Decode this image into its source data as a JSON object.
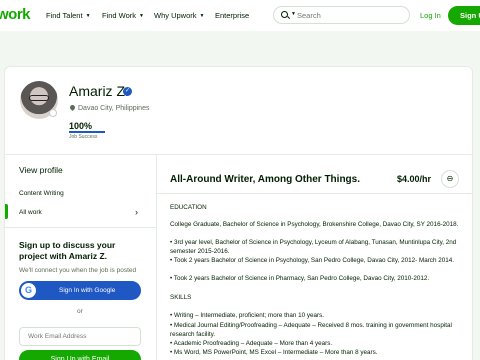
{
  "nav": {
    "logo": "work",
    "items": [
      "Find Talent",
      "Find Work",
      "Why Upwork",
      "Enterprise"
    ],
    "search_placeholder": "Search",
    "login": "Log In",
    "signup": "Sign Up"
  },
  "profile": {
    "name": "Amariz Z.",
    "location": "Davao City, Philippines",
    "job_success": "100%",
    "job_success_label": "Job Success",
    "job_success_fraction": 1.0
  },
  "sidebar": {
    "view_profile": "View profile",
    "items": [
      "Content Writing",
      "All work"
    ],
    "signup_title": "Sign up to discuss your project with Amariz Z.",
    "signup_sub": "We'll connect you when the job is posted",
    "google_button": "Sign In with Google",
    "or": "or",
    "email_placeholder": "Work Email Address",
    "email_button": "Sign Up with Email"
  },
  "main": {
    "title": "All-Around Writer, Among Other Things.",
    "rate": "$4.00/hr",
    "lines": [
      "EDUCATION",
      "College Graduate, Bachelor of Science in Psychology, Brokenshire College, Davao City, SY 2016-2018.",
      "• 3rd year level, Bachelor of Science in Psychology, Lyceum of Alabang, Tunasan, Muntinlupa City, 2nd semester 2015-2016.",
      "• Took 2 years Bachelor of Science in Psychology, San Pedro College, Davao City, 2012- March 2014.",
      "• Took 2 years Bachelor of Science in Pharmacy, San Pedro College, Davao City, 2010-2012.",
      "SKILLS",
      "• Writing – Intermediate, proficient; more than 10 years.",
      "• Medical Journal Editing/Proofreading – Adequate – Received 8 mos. training in government hospital research facility.",
      "• Academic Proofreading – Adequate – More than 4 years.",
      "• Ms Word, MS PowerPoint, MS Excel – Intermediate – More than 8 years."
    ]
  }
}
